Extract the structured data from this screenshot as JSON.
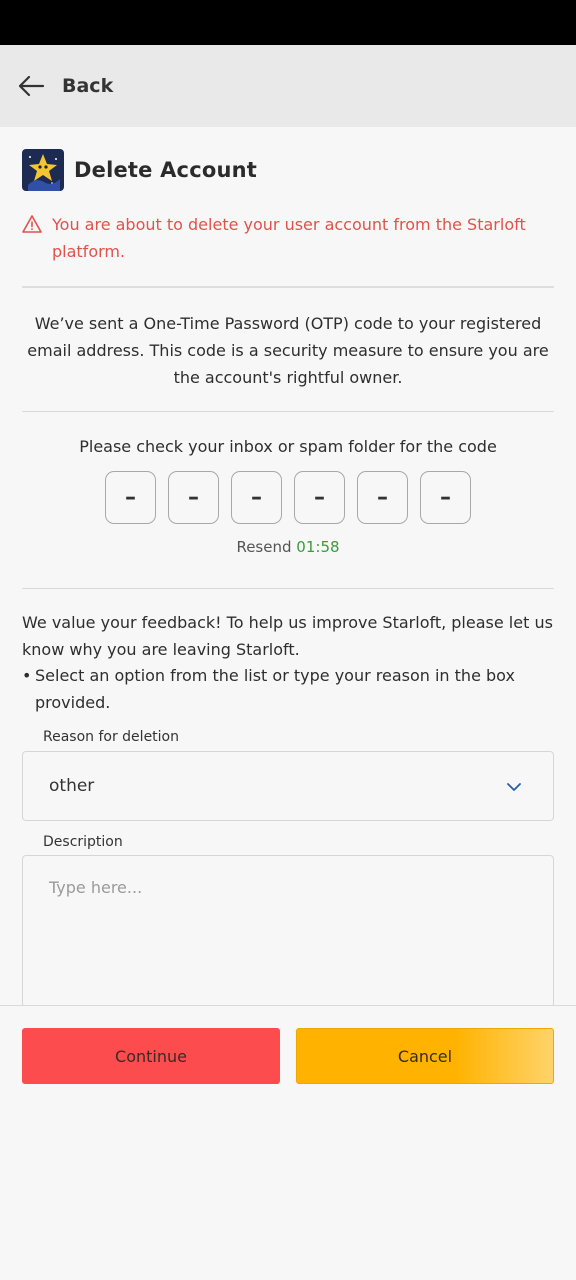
{
  "app_bar": {
    "back_label": "Back"
  },
  "header": {
    "title": "Delete Account",
    "logo_icon": "starloft-logo"
  },
  "warning": {
    "text": "You are about to delete your user account from the Starloft platform.",
    "color": "#e0524c"
  },
  "otp_info": "We’ve sent a One-Time Password (OTP) code to your registered email address. This code is a security measure to ensure you are the account's rightful owner.",
  "otp": {
    "instruction": "Please check your inbox or spam folder for the code",
    "digits": [
      "–",
      "–",
      "–",
      "–",
      "–",
      "–"
    ],
    "resend_label": "Resend",
    "timer": "01:58",
    "timer_color": "#3a9d3a"
  },
  "feedback": {
    "intro": "We value your feedback! To help us improve Starloft, please let us know why you are leaving Starloft.",
    "bullet": "Select an option from the list or type your reason in the box provided."
  },
  "reason": {
    "label": "Reason for deletion",
    "selected": "other"
  },
  "description": {
    "label": "Description",
    "placeholder": "Type here...",
    "value": ""
  },
  "buttons": {
    "continue": "Continue",
    "cancel": "Cancel",
    "continue_color": "#fc4c4e",
    "cancel_color": "#ffb300"
  }
}
